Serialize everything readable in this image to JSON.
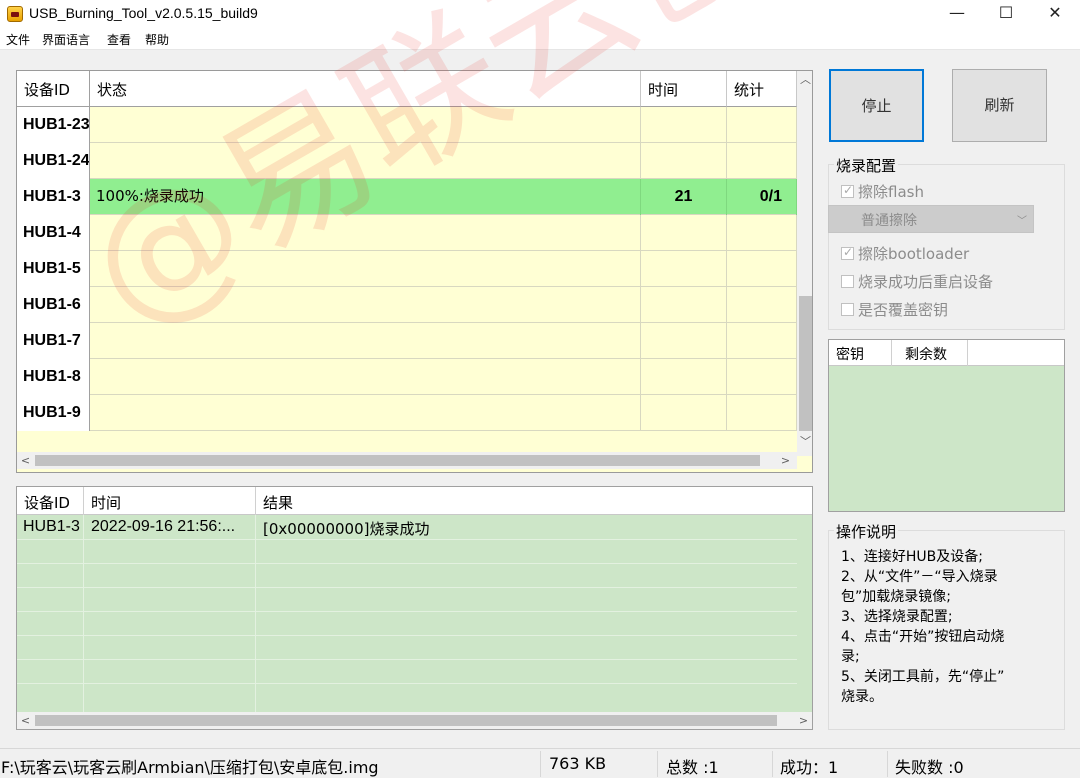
{
  "window": {
    "title": "USB_Burning_Tool_v2.0.5.15_build9",
    "minimize": "—",
    "maximize": "☐",
    "close": "✕"
  },
  "menu": [
    "文件",
    "界面语言",
    "查看",
    "帮助"
  ],
  "device_grid": {
    "headers": {
      "id": "设备ID",
      "status": "状态",
      "time": "时间",
      "stat": "统计"
    },
    "rows": [
      {
        "id": "HUB1-23",
        "status": "",
        "time": "",
        "stat": ""
      },
      {
        "id": "HUB1-24",
        "status": "",
        "time": "",
        "stat": ""
      },
      {
        "id": "HUB1-3",
        "status": "100%:烧录成功",
        "time": "21",
        "stat": "0/1"
      },
      {
        "id": "HUB1-4",
        "status": "",
        "time": "",
        "stat": ""
      },
      {
        "id": "HUB1-5",
        "status": "",
        "time": "",
        "stat": ""
      },
      {
        "id": "HUB1-6",
        "status": "",
        "time": "",
        "stat": ""
      },
      {
        "id": "HUB1-7",
        "status": "",
        "time": "",
        "stat": ""
      },
      {
        "id": "HUB1-8",
        "status": "",
        "time": "",
        "stat": ""
      },
      {
        "id": "HUB1-9",
        "status": "",
        "time": "",
        "stat": ""
      }
    ],
    "success_color": "#90ee90",
    "row_bg": "#ffffd4"
  },
  "buttons": {
    "stop": "停止",
    "refresh": "刷新"
  },
  "burn_config": {
    "title": "烧录配置",
    "erase_flash": "擦除flash",
    "erase_mode": "普通擦除",
    "erase_bootloader": "擦除bootloader",
    "reboot_after": "烧录成功后重启设备",
    "overwrite_key": "是否覆盖密钥"
  },
  "key_list": {
    "headers": {
      "key": "密钥",
      "remaining": "剩余数"
    }
  },
  "log": {
    "headers": {
      "id": "设备ID",
      "time": "时间",
      "result": "结果"
    },
    "rows": [
      {
        "id": "HUB1-3",
        "time": "2022-09-16 21:56:...",
        "result": "[0x00000000]烧录成功"
      }
    ]
  },
  "help": {
    "title": "操作说明",
    "lines": [
      "1、连接好HUB及设备;",
      "2、从“文件”－“导入烧录",
      "包”加载烧录镜像;",
      "3、选择烧录配置;",
      "4、点击“开始”按钮启动烧",
      "录;",
      "5、关闭工具前，先“停止”",
      "烧录。"
    ]
  },
  "statusbar": {
    "path": "F:\\玩客云\\玩客云刷Armbian\\压缩打包\\安卓底包.img",
    "size": "763 KB",
    "total": "总数 :1",
    "success": "成功：1",
    "fail": "失败数 :0"
  },
  "watermark": "@易联云创"
}
